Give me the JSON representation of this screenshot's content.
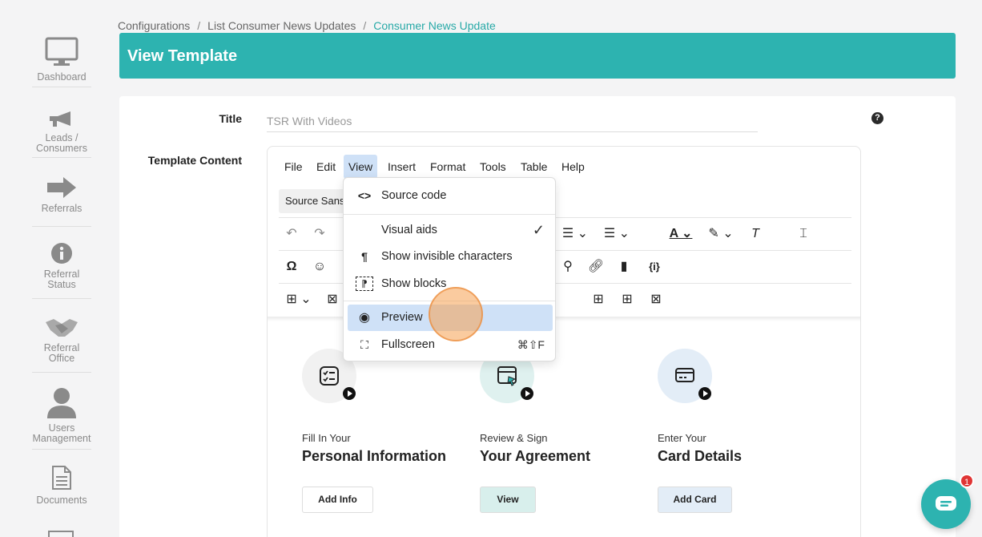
{
  "sidebar": {
    "items": [
      {
        "label": "Dashboard"
      },
      {
        "label": "Leads / Consumers"
      },
      {
        "label": "Referrals"
      },
      {
        "label": "Referral Status"
      },
      {
        "label": "Referral Office"
      },
      {
        "label": "Users Management"
      },
      {
        "label": "Documents"
      }
    ]
  },
  "breadcrumb": {
    "items": [
      "Configurations",
      "List Consumer News Updates",
      "Consumer News Update"
    ],
    "separator": "/"
  },
  "header": {
    "title": "View Template"
  },
  "form": {
    "title_label": "Title",
    "title_value": "TSR With Videos",
    "content_label": "Template Content",
    "help_glyph": "?"
  },
  "editor": {
    "menubar": [
      "File",
      "Edit",
      "View",
      "Insert",
      "Format",
      "Tools",
      "Table",
      "Help"
    ],
    "font_select": "Source Sans Pro",
    "view_menu": [
      {
        "icon": "<>",
        "label": "Source code",
        "shortcut": ""
      },
      {
        "icon": "",
        "label": "Visual aids",
        "shortcut": "✓"
      },
      {
        "icon": "¶",
        "label": "Show invisible characters",
        "shortcut": ""
      },
      {
        "icon": "⁋",
        "label": "Show blocks",
        "shortcut": ""
      },
      {
        "icon": "◉",
        "label": "Preview",
        "shortcut": ""
      },
      {
        "icon": "⛶",
        "label": "Fullscreen",
        "shortcut": "⌘⇧F"
      }
    ],
    "steps": [
      {
        "small": "Fill In Your",
        "big": "Personal Information",
        "button": "Add Info",
        "color": "#f1f1f1"
      },
      {
        "small": "Review & Sign",
        "big": "Your Agreement",
        "button": "View",
        "color": "#dff1ef"
      },
      {
        "small": "Enter Your",
        "big": "Card Details",
        "button": "Add Card",
        "color": "#e3edf7"
      }
    ]
  },
  "chat": {
    "badge": "1"
  },
  "colors": {
    "accent": "#2db3b0",
    "menu_highlight": "#cfe1f7"
  }
}
